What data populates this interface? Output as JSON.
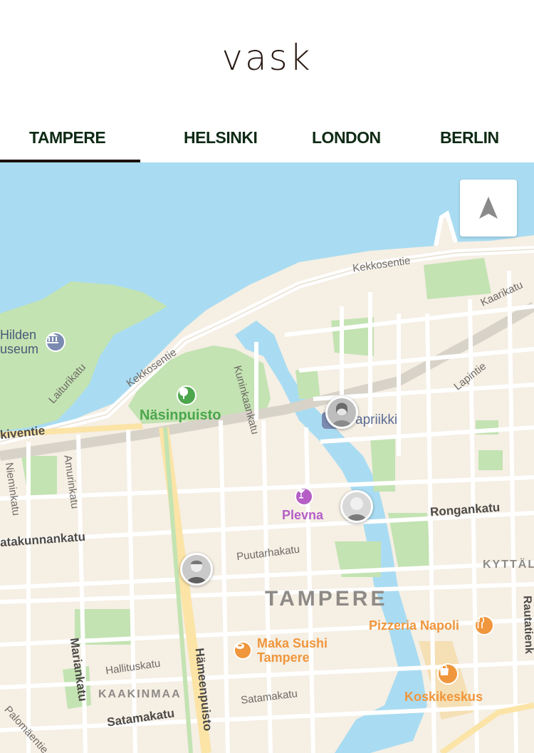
{
  "brand": {
    "logo_text": "vask"
  },
  "tabs": [
    {
      "label": "TAMPERE",
      "active": true
    },
    {
      "label": "HELSINKI",
      "active": false
    },
    {
      "label": "LONDON",
      "active": false
    },
    {
      "label": "BERLIN",
      "active": false
    }
  ],
  "map": {
    "city_label": "TAMPERE",
    "districts": {
      "kyttala": "KYTTÄL",
      "kaakinmaa": "KAAKINMAA"
    },
    "streets": {
      "kekkosentie_1": "Kekkosentie",
      "kekkosentie_2": "Kekkosentie",
      "kaarikatu": "Kaarikatu",
      "lapintie": "Lapintie",
      "laiturikatu": "Laiturikatu",
      "kuninkaankatu": "Kuninkaankatu",
      "viventie": "kiventie",
      "amurinkatu": "Amurinkatu",
      "nieminkatu": "Nieminkatu",
      "satakunnankatu": "atakunnankatu",
      "puutarhakatu": "Puutarhakatu",
      "rongankatu": "Rongankatu",
      "mariankatu": "Mariankatu",
      "hallituskatu": "Hallituskatu",
      "hameenpuisto": "Hämeenpuisto",
      "satamakatu_1": "Satamakatu",
      "satamakatu_2": "Satamakatu",
      "palomaentie": "Palomäentie",
      "rautatienkatu": "Rautatienk"
    },
    "pois": {
      "hilden_line1": "Hilden",
      "hilden_line2": "useum",
      "nasinpuisto": "Näsinpuisto",
      "vapriikki": "apriikki",
      "plevna": "Plevna",
      "maka_sushi_line1": "Maka Sushi",
      "maka_sushi_line2": "Tampere",
      "pizzeria_napoli": "Pizzeria Napoli",
      "koskikeskus": "Koskikeskus"
    },
    "colors": {
      "water": "#a9dcf2",
      "land": "#f5efe4",
      "park": "#c3e3b2",
      "road": "#ffffff",
      "main_road": "#fbe4a6",
      "poi_green": "#4ca64c",
      "poi_purple": "#b55ec6",
      "poi_orange": "#f0963c",
      "label_gray": "#6f6a66"
    }
  },
  "controls": {
    "locate_icon": "navigation-arrow-icon"
  }
}
